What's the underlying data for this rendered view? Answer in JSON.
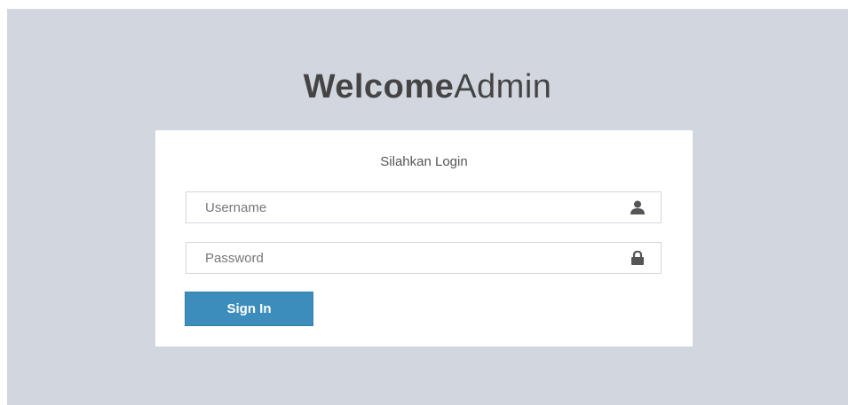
{
  "logo": {
    "bold": "Welcome",
    "light": "Admin"
  },
  "login": {
    "message": "Silahkan Login",
    "username": {
      "placeholder": "Username",
      "value": "",
      "icon": "user-icon"
    },
    "password": {
      "placeholder": "Password",
      "value": "",
      "icon": "lock-icon"
    },
    "signin_label": "Sign In"
  },
  "colors": {
    "background": "#d2d6de",
    "button": "#3c8dbc",
    "icon": "#555555"
  }
}
